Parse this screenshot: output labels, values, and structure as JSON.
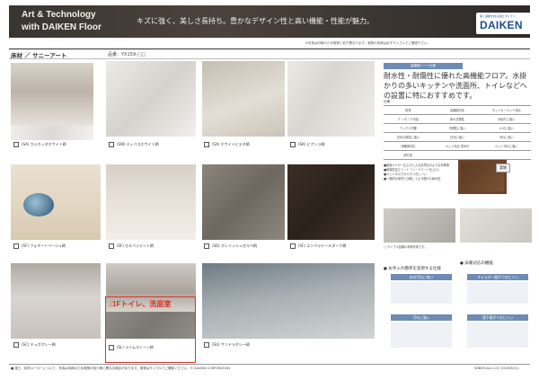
{
  "banner": {
    "line1": "Art & Technology",
    "line2": "with DAIKEN Floor",
    "tagline": "キズに強く、美しさ長持ち。豊かなデザイン性と高い機能・性能が魅力。"
  },
  "logo": {
    "small_text": "夢と感動を創る会社 ダイケン",
    "brand": "DAIKEN"
  },
  "title": {
    "text": "床材 ／ サニーアート",
    "code": "品番：YX159-□□"
  },
  "top_note": "※写真は印刷のため実物と若干異なります。実際の色柄は必ずサンプルでご確認下さい。",
  "swatches": [
    {
      "caption": "(SA) カルカッタホワイト柄"
    },
    {
      "caption": "(SW) ディベスホワイト柄"
    },
    {
      "caption": "(SX) ホワイトビエネ柄"
    },
    {
      "caption": "(SK) ビアンコ柄"
    },
    {
      "caption": "(SF) フォギートベージュ柄"
    },
    {
      "caption": "(SF) セルベジャント柄"
    },
    {
      "caption": "(SD) グレイッシュセルペ柄"
    },
    {
      "caption": "(SF) エンペラドールダーク柄"
    },
    {
      "caption": "(SC) チュガグレー柄"
    },
    {
      "caption": "(SL) ライムストーン柄"
    },
    {
      "caption": "(SU) サンドラグレー柄"
    }
  ],
  "callout": "↓1Fトイレ、洗面室",
  "right": {
    "header": "高機能シート仕様",
    "description": "耐水性・耐傷性に優れた高機能フロア。水掛かりの多いキッチンや洗面所、トイレなどへの設置に特におすすめです。",
    "spec_title": "仕様",
    "spec_rows": [
      [
        "防滑",
        "高機能対応",
        "ホットカーペット対応"
      ],
      [
        "ア ンモニア対応",
        "床の日照性",
        "水回りに強い"
      ],
      [
        "ワックス不要",
        "不燃性に強い",
        "キズに強い"
      ],
      [
        "日光の熱性に強い",
        "日光に強い",
        "汚れに強い"
      ],
      [
        "床暖房対応",
        "ペット対応 重歩行",
        "ペット汚れに強い"
      ],
      [
        "耐久性",
        "",
        ""
      ]
    ],
    "feature_bullets": [
      "■紙面ジャガー仕上げによる天然石のような本物感",
      "■耐傷性加工シート「ハードコート仕上げ」",
      "■ペットの爪でもキズつきにくい",
      "■一般的な床材と比較してより優れた耐水性"
    ],
    "sample_label": "実物",
    "sample_caption": "□ サンプル品番の本物写真です。",
    "clean_title": "● お手入れ簡単を実現する仕様",
    "clean_pill1": "水の汚れに強い",
    "clean_pill2": "汚れに強い",
    "func_title": "● 床暖対応の機能",
    "func_pill1": "キャスター傷がつきにくい",
    "func_pill2": "落下傷がつきにくい"
  },
  "footer": {
    "left": "■ 施工：床材メーカーについて、写真は印刷のため実際の色や柄と異なる場合があります。実物はサンプルでご確認ください。© DAIKEN CORPORATION",
    "right": "SDB0F2AA-1-01 (2025/8/31)"
  },
  "colors": {
    "accent_red": "#d9362b",
    "accent_blue": "#6d8bb5",
    "brand_blue": "#1c4f8f"
  }
}
